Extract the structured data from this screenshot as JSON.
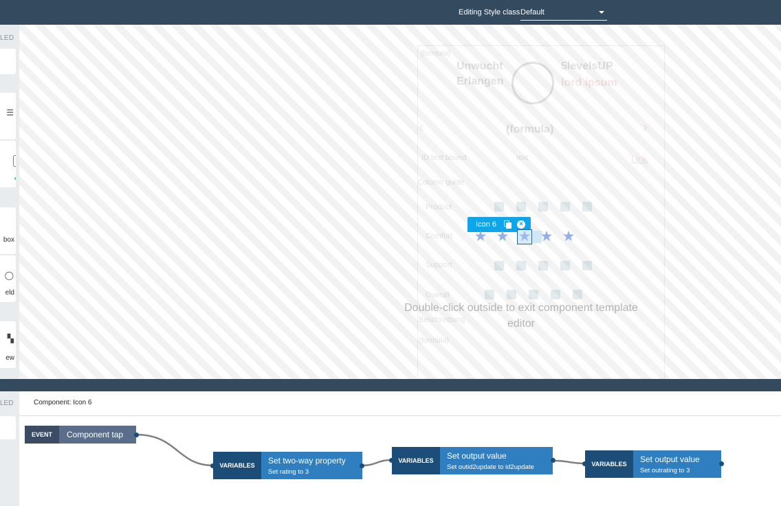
{
  "topbar": {
    "style_label": "Editing Style class",
    "style_value": "Default"
  },
  "left_panel": {
    "header": "LED",
    "cards": [
      {
        "label": ""
      },
      {
        "label": ""
      },
      {
        "label": ""
      },
      {
        "label": "box",
        "icon": "checkbox-icon"
      },
      {
        "label": "eld",
        "icon": "field-icon"
      },
      {
        "label": "ew",
        "icon": "view-icon"
      }
    ]
  },
  "canvas": {
    "overlay_message": "Double-click outside to exit component template editor",
    "selection": {
      "name": "Icon 6"
    },
    "stars": {
      "count": 5,
      "selected_index": 2,
      "color": "#8fb0ea"
    },
    "ghost": {
      "formula_top": "(formula)",
      "brand_left_1": "Unwucht",
      "brand_left_2": "Erlangen",
      "brand_right_1": "5levelsUP",
      "brand_right_2": "lord ipsum",
      "title": "(formula)",
      "link": "Link",
      "col_a": "ID text bound",
      "col_b": "text",
      "section": "Column guide",
      "rows": [
        "Product",
        "Comfort",
        "Support",
        "Overall"
      ],
      "footer_label": "Beschreibung",
      "footer_value": "(formula)"
    }
  },
  "left_panel_bottom": {
    "header": "LED"
  },
  "logic": {
    "header": "Component: Icon 6",
    "event": {
      "tag": "EVENT",
      "title": "Component tap"
    },
    "nodes": [
      {
        "tag": "VARIABLES",
        "title": "Set two-way property",
        "sub": "Set rating to 3"
      },
      {
        "tag": "VARIABLES",
        "title": "Set output value",
        "sub": "Set outid2update to id2update"
      },
      {
        "tag": "VARIABLES",
        "title": "Set output value",
        "sub": "Set outrating to 3"
      }
    ]
  },
  "colors": {
    "topbar": "#344a5e",
    "selection": "#0fa6e9",
    "node_tag": "#1b4d78",
    "node_body": "#2f7ec0",
    "event_tag": "#3b4c63",
    "event_body": "#5a6e8b"
  }
}
